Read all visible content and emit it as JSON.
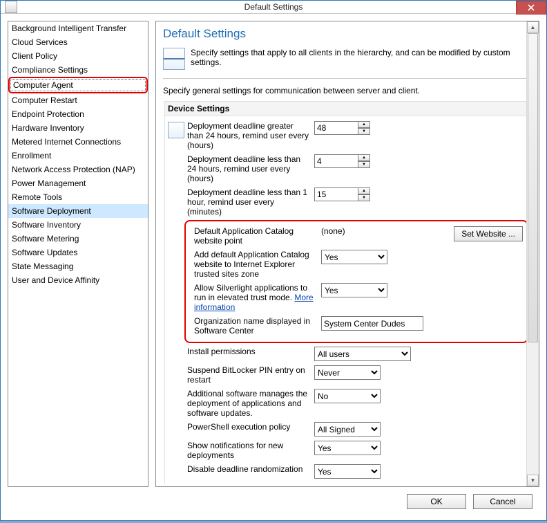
{
  "window": {
    "title": "Default Settings"
  },
  "sidebar": {
    "items": [
      "Background Intelligent Transfer",
      "Cloud Services",
      "Client Policy",
      "Compliance Settings",
      "Computer Agent",
      "Computer Restart",
      "Endpoint Protection",
      "Hardware Inventory",
      "Metered Internet Connections",
      "Enrollment",
      "Network Access Protection (NAP)",
      "Power Management",
      "Remote Tools",
      "Software Deployment",
      "Software Inventory",
      "Software Metering",
      "Software Updates",
      "State Messaging",
      "User and Device Affinity"
    ],
    "highlighted_index": 4,
    "selected_index": 13
  },
  "content": {
    "page_title": "Default Settings",
    "header_desc": "Specify settings that apply to all clients in the hierarchy, and can be modified by custom settings.",
    "section_intro": "Specify general settings for communication between server and client.",
    "device_header": "Device Settings",
    "rows": {
      "r1": {
        "label": "Deployment deadline greater than 24 hours, remind user every (hours)",
        "value": "48"
      },
      "r2": {
        "label": "Deployment deadline less than 24 hours, remind user every (hours)",
        "value": "4"
      },
      "r3": {
        "label": "Deployment deadline less than 1 hour, remind user every (minutes)",
        "value": "15"
      },
      "r4": {
        "label": "Default Application Catalog website point",
        "value": "(none)",
        "button": "Set Website ..."
      },
      "r5": {
        "label": "Add default Application Catalog website to Internet Explorer trusted sites zone",
        "value": "Yes"
      },
      "r6": {
        "label_a": "Allow Silverlight applications to run in elevated trust mode. ",
        "link": "More information",
        "value": "Yes"
      },
      "r7": {
        "label": "Organization name displayed in Software Center",
        "value": "System Center Dudes"
      },
      "r8": {
        "label": "Install permissions",
        "value": "All users"
      },
      "r9": {
        "label": "Suspend BitLocker PIN entry on restart",
        "value": "Never"
      },
      "r10": {
        "label": "Additional software manages the deployment of applications and software updates.",
        "value": "No"
      },
      "r11": {
        "label": "PowerShell execution policy",
        "value": "All Signed"
      },
      "r12": {
        "label": "Show notifications for new deployments",
        "value": "Yes"
      },
      "r13": {
        "label": "Disable deadline randomization",
        "value": "Yes"
      }
    }
  },
  "footer": {
    "ok": "OK",
    "cancel": "Cancel"
  }
}
